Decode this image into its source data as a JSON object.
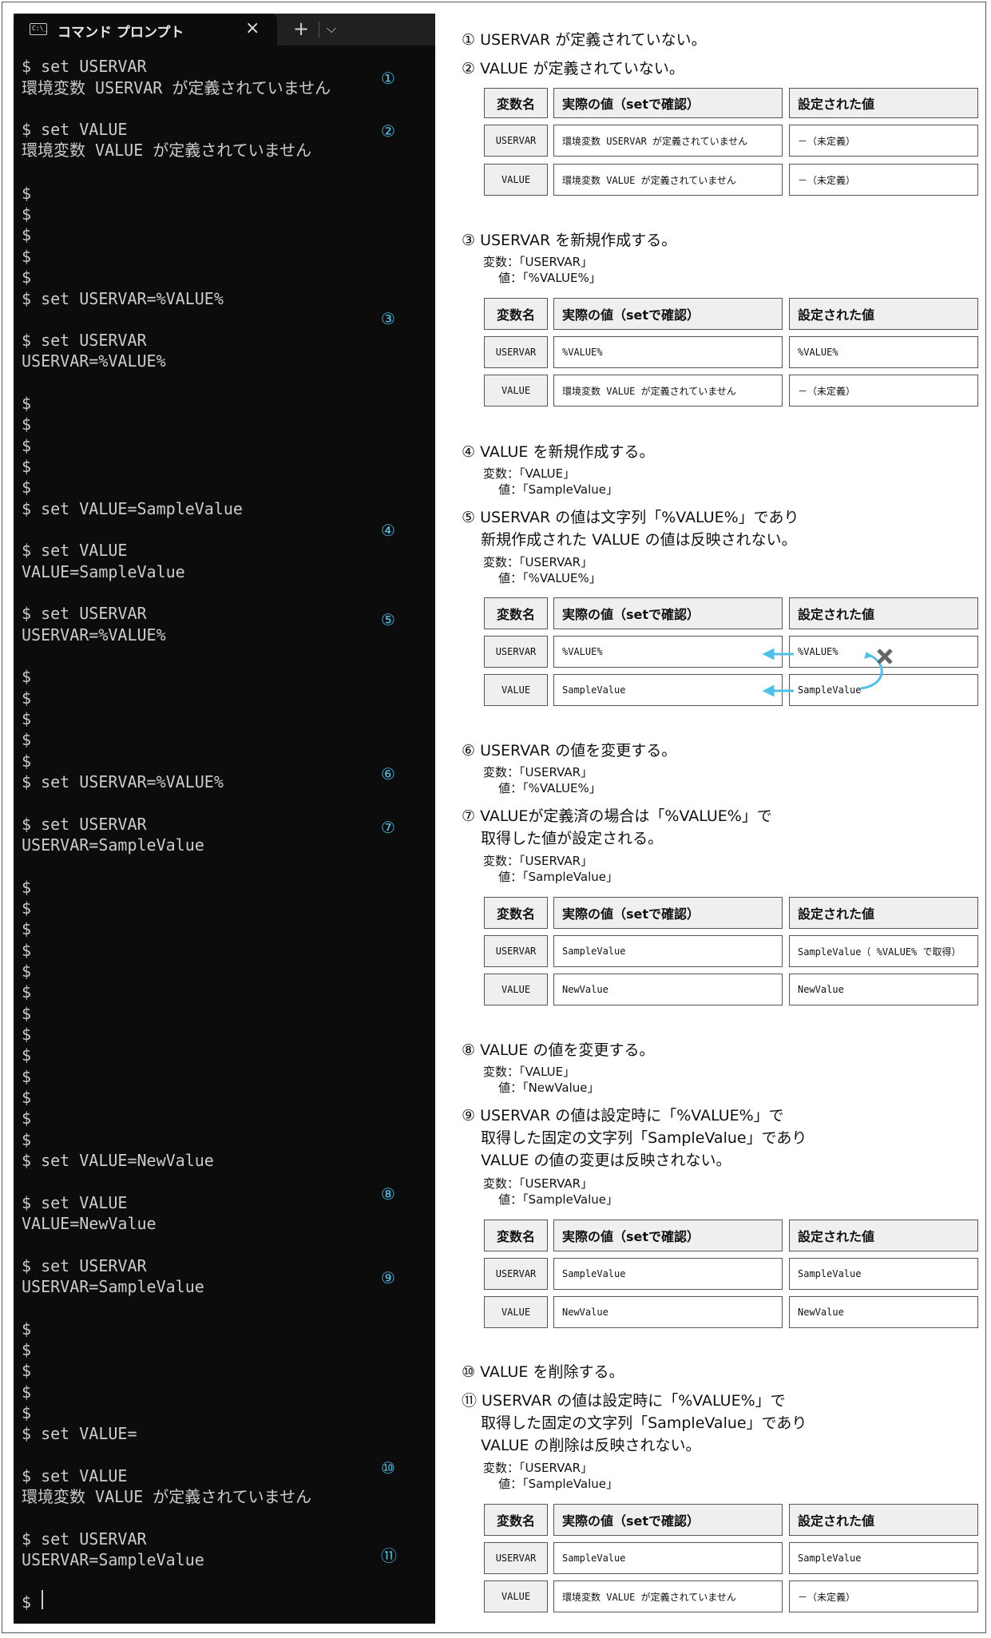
{
  "terminal": {
    "tab_title": "コマンド プロンプト",
    "tab_icon_text": "C:\\_",
    "close_glyph": "×",
    "new_tab_glyph": "+",
    "dropdown_glyph": "⌵",
    "lines": [
      "$ set USERVAR",
      "環境変数 USERVAR が定義されていません",
      "$ set VALUE",
      "環境変数 VALUE が定義されていません",
      "$",
      "$",
      "$",
      "$",
      "$",
      "$ set USERVAR=%VALUE%",
      "$ set USERVAR",
      "USERVAR=%VALUE%",
      "$",
      "$",
      "$",
      "$",
      "$",
      "$ set VALUE=SampleValue",
      "$ set VALUE",
      "VALUE=SampleValue",
      "$ set USERVAR",
      "USERVAR=%VALUE%",
      "$",
      "$",
      "$",
      "$",
      "$",
      "$ set USERVAR=%VALUE%",
      "$ set USERVAR",
      "USERVAR=SampleValue",
      "$",
      "$",
      "$",
      "$",
      "$",
      "$",
      "$",
      "$",
      "$",
      "$",
      "$",
      "$",
      "$",
      "$ set VALUE=NewValue",
      "$ set VALUE",
      "VALUE=NewValue",
      "$ set USERVAR",
      "USERVAR=SampleValue",
      "$",
      "$",
      "$",
      "$",
      "$",
      "$ set VALUE=",
      "$ set VALUE",
      "環境変数 VALUE が定義されていません",
      "$ set USERVAR",
      "USERVAR=SampleValue",
      "$ "
    ],
    "markers": [
      "①",
      "②",
      "③",
      "④",
      "⑤",
      "⑥",
      "⑦",
      "⑧",
      "⑨",
      "⑩",
      "⑪"
    ]
  },
  "steps": [
    "① USERVAR が定義されていない。",
    "② VALUE が定義されていない。",
    "③ USERVAR を新規作成する。",
    "④ VALUE を新規作成する。",
    "⑤ USERVAR の値は文字列「%VALUE%」であり\n    新規作成された VALUE の値は反映されない。",
    "⑥ USERVAR の値を変更する。",
    "⑦ VALUEが定義済の場合は「%VALUE%」で\n    取得した値が設定される。",
    "⑧ VALUE の値を変更する。",
    "⑨ USERVAR の値は設定時に「%VALUE%」で\n    取得した固定の文字列「SampleValue」であり\n    VALUE の値の変更は反映されない。",
    "⑩ VALUE を削除する。",
    "⑪ USERVAR の値は設定時に「%VALUE%」で\n    取得した固定の文字列「SampleValue」であり\n    VALUE の削除は反映されない。"
  ],
  "subs": [
    "変数：「USERVAR」\n    値：「%VALUE%」",
    "変数：「VALUE」\n    値：「SampleValue」",
    "変数：「USERVAR」\n    値：「%VALUE%」",
    "変数：「USERVAR」\n    値：「%VALUE%」",
    "変数：「USERVAR」\n    値：「SampleValue」",
    "変数：「VALUE」\n    値：「NewValue」",
    "変数：「USERVAR」\n    値：「SampleValue」",
    "変数：「USERVAR」\n    値：「SampleValue」"
  ],
  "table_headers": [
    "変数名",
    "実際の値（setで確認）",
    "設定された値"
  ],
  "tables": [
    [
      [
        "USERVAR",
        "環境変数 USERVAR が定義されていません",
        "－（未定義）"
      ],
      [
        "VALUE",
        "環境変数 VALUE が定義されていません",
        "－（未定義）"
      ]
    ],
    [
      [
        "USERVAR",
        "%VALUE%",
        "%VALUE%"
      ],
      [
        "VALUE",
        "環境変数 VALUE が定義されていません",
        "－（未定義）"
      ]
    ],
    [
      [
        "USERVAR",
        "%VALUE%",
        "%VALUE%"
      ],
      [
        "VALUE",
        "SampleValue",
        "SampleValue"
      ]
    ],
    [
      [
        "USERVAR",
        "SampleValue",
        "SampleValue（ %VALUE% で取得）"
      ],
      [
        "VALUE",
        "NewValue",
        "NewValue"
      ]
    ],
    [
      [
        "USERVAR",
        "SampleValue",
        "SampleValue"
      ],
      [
        "VALUE",
        "NewValue",
        "NewValue"
      ]
    ],
    [
      [
        "USERVAR",
        "SampleValue",
        "SampleValue"
      ],
      [
        "VALUE",
        "環境変数 VALUE が定義されていません",
        "－（未定義）"
      ]
    ]
  ],
  "colors": {
    "accent": "#4fc1e9",
    "terminal_bg": "#0c0c0c",
    "cross": "#666666"
  }
}
